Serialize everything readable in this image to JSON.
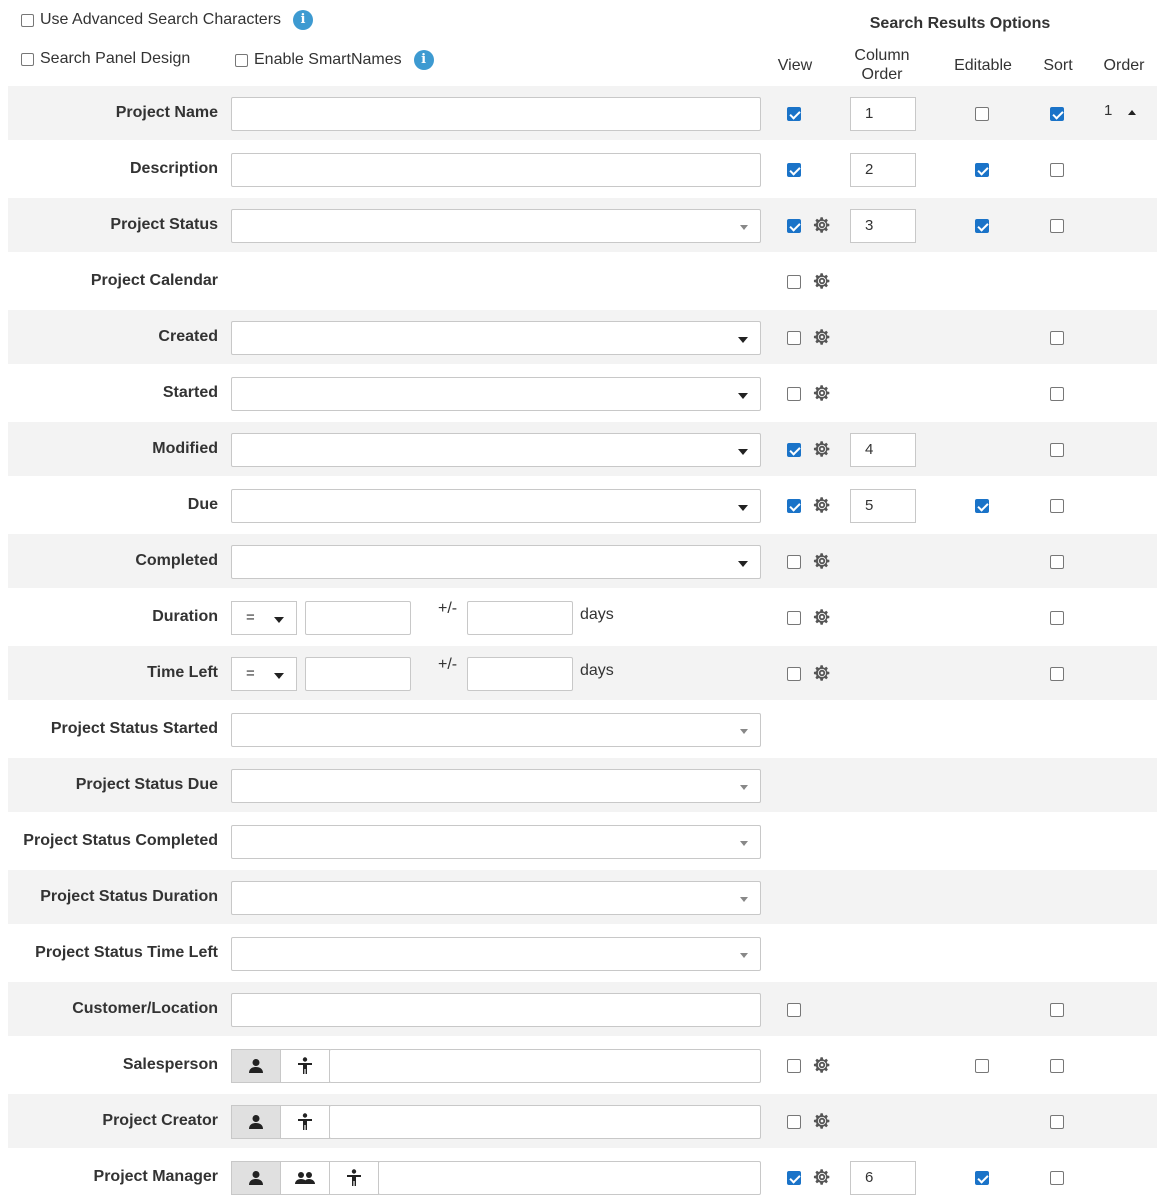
{
  "options": {
    "advanced_search": "Use Advanced Search Characters",
    "panel_design": "Search Panel Design",
    "smartnames": "Enable SmartNames",
    "info_glyph": "i"
  },
  "headers": {
    "search_results_options": "Search Results Options",
    "view": "View",
    "column_order": "Column Order",
    "column_order_line1": "Column",
    "column_order_line2": "Order",
    "editable": "Editable",
    "sort": "Sort",
    "order": "Order"
  },
  "rows": [
    {
      "label": "Project Name",
      "view": true,
      "column_order": "1",
      "editable": false,
      "sort": true,
      "order": "1"
    },
    {
      "label": "Description",
      "view": true,
      "column_order": "2",
      "editable": true,
      "sort": false
    },
    {
      "label": "Project Status",
      "view": true,
      "column_order": "3",
      "editable": true,
      "sort": false
    },
    {
      "label": "Project Calendar",
      "view": false
    },
    {
      "label": "Created",
      "view": false,
      "sort": false
    },
    {
      "label": "Started",
      "view": false,
      "sort": false
    },
    {
      "label": "Modified",
      "view": true,
      "column_order": "4",
      "sort": false
    },
    {
      "label": "Due",
      "view": true,
      "column_order": "5",
      "editable": true,
      "sort": false
    },
    {
      "label": "Completed",
      "view": false,
      "sort": false
    },
    {
      "label": "Duration",
      "operator": "=",
      "plus_minus": "+/-",
      "unit": "days",
      "view": false,
      "sort": false
    },
    {
      "label": "Time Left",
      "operator": "=",
      "plus_minus": "+/-",
      "unit": "days",
      "view": false,
      "sort": false
    },
    {
      "label": "Project Status Started"
    },
    {
      "label": "Project Status Due"
    },
    {
      "label": "Project Status Completed"
    },
    {
      "label": "Project Status Duration"
    },
    {
      "label": "Project Status Time Left"
    },
    {
      "label": "Customer/Location",
      "view": false,
      "sort": false
    },
    {
      "label": "Salesperson",
      "view": false,
      "editable": false,
      "sort": false
    },
    {
      "label": "Project Creator",
      "view": false,
      "sort": false
    },
    {
      "label": "Project Manager",
      "view": true,
      "column_order": "6",
      "editable": true,
      "sort": false
    }
  ],
  "colors": {
    "checked": "#1a73c8",
    "info": "#3d9ad1",
    "row_shade": "#f3f3f3"
  },
  "icons": [
    "info-icon",
    "gear-icon",
    "dropdown-caret-icon",
    "person-icon",
    "people-icon",
    "accessibility-icon",
    "sort-ascending-icon"
  ]
}
